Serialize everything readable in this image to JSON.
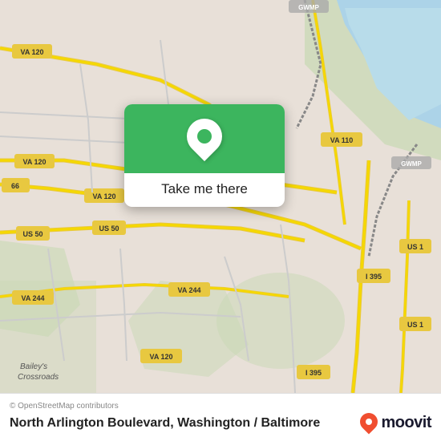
{
  "map": {
    "attribution": "© OpenStreetMap contributors",
    "roads": {
      "va120_color": "#e8c840",
      "us50_color": "#e8c840",
      "va244_color": "#e8c840",
      "i395_color": "#e8c840",
      "bg_color": "#e8e0d8",
      "water_color": "#acd3e8",
      "green_color": "#c8d8b8"
    }
  },
  "popup": {
    "label": "Take me there",
    "icon_color": "#3cb55e"
  },
  "bottom_bar": {
    "attribution": "© OpenStreetMap contributors",
    "location_name": "North Arlington Boulevard, Washington / Baltimore"
  },
  "moovit": {
    "text": "moovit",
    "pin_color": "#f04e30"
  },
  "icons": {
    "location_pin": "📍",
    "moovit_pin": "📍"
  }
}
